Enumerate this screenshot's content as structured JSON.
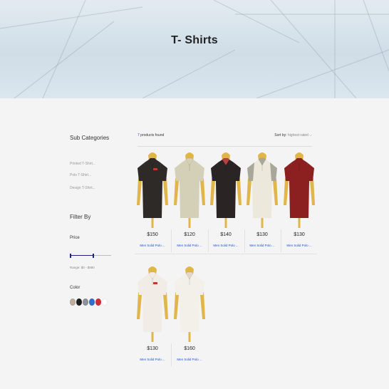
{
  "hero": {
    "title": "T- Shirts"
  },
  "sidebar": {
    "sub_heading": "Sub Categories",
    "sub_items": [
      "Printed T-Shirt...",
      "Polo T-Shirt...",
      "Design T-Shirt..."
    ],
    "filter_heading": "Filter By",
    "price_label": "Price",
    "price_range_text": "Range: $0 - $980",
    "price_range": {
      "min": 0,
      "max": 980,
      "selected_min": 0,
      "selected_max": 560
    },
    "color_label": "Color",
    "colors": [
      "#bcaea0",
      "#1e1e1e",
      "#8f9296",
      "#2f6fd1",
      "#cf2d3a",
      "#ffffff"
    ]
  },
  "toolbar": {
    "found_count": "7",
    "found_text": " products found",
    "sort_label": "Sort by: ",
    "sort_value": "highest rated ⌵"
  },
  "products": [
    {
      "price": "$150",
      "name": "Men Solid Polo ...",
      "body": "#2e2a28",
      "sleeve": "#2e2a28",
      "collar": "#2e2a28",
      "print": "#c0392b",
      "icon": "polo-tshirt-icon"
    },
    {
      "price": "$120",
      "name": "Men Solid Polo ...",
      "body": "#d4d0b8",
      "sleeve": "#d4d0b8",
      "collar": "#d4d0b8",
      "print": "",
      "icon": "polo-tshirt-icon"
    },
    {
      "price": "$140",
      "name": "Men Solid Polo ...",
      "body": "#2a2424",
      "sleeve": "#2a2424",
      "collar": "#b84040",
      "print": "",
      "icon": "polo-tshirt-icon"
    },
    {
      "price": "$130",
      "name": "Men Solid Polo ...",
      "body": "#ece9dc",
      "sleeve": "#a8a89a",
      "collar": "#a8a89a",
      "print": "",
      "icon": "raglan-tshirt-icon"
    },
    {
      "price": "$130",
      "name": "Men Solid Polo ...",
      "body": "#8c1f1f",
      "sleeve": "#8c1f1f",
      "collar": "#8c1f1f",
      "print": "",
      "icon": "polo-tshirt-icon"
    },
    {
      "price": "$130",
      "name": "Men Solid Polo ...",
      "body": "#f1ede6",
      "sleeve": "#f1ede6",
      "collar": "#f1ede6",
      "print": "#c0392b",
      "icon": "polo-tshirt-icon"
    },
    {
      "price": "$160",
      "name": "Men Solid Polo ...",
      "body": "#f3f0ea",
      "sleeve": "#f3f0ea",
      "collar": "#e0d8c8",
      "print": "",
      "icon": "polo-tshirt-icon"
    }
  ]
}
